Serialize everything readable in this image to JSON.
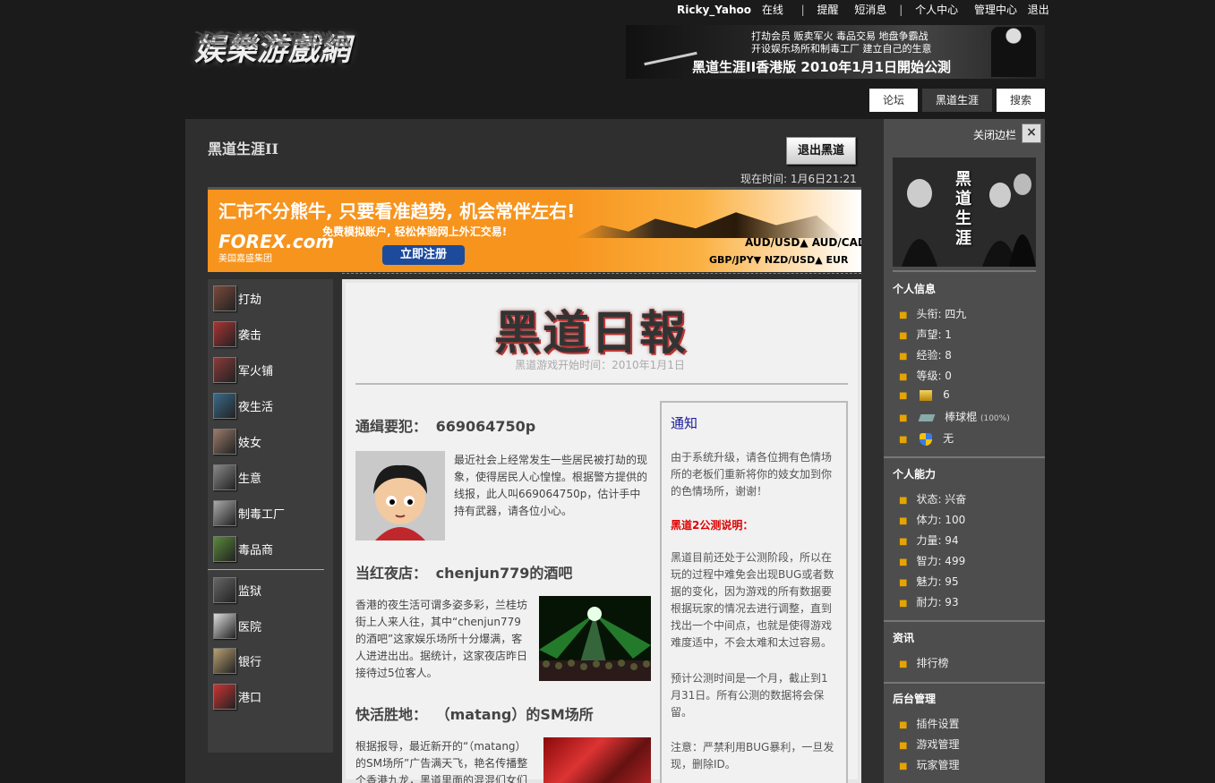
{
  "topbar": {
    "user": "Ricky_Yahoo",
    "online": "在线",
    "sep": "|",
    "remind": "提醒",
    "pm": "短消息",
    "usercenter": "个人中心",
    "admin": "管理中心",
    "logout": "退出"
  },
  "logo": {
    "text": "娱樂游戲網"
  },
  "top_banner": {
    "line1": "打劫会员  贩卖军火  毒品交易  地盘争霸战",
    "line2": "开设娱乐场所和制毒工厂  建立自己的生意",
    "line3": "黑道生涯II香港版 2010年1月1日開始公測"
  },
  "nav": [
    {
      "label": "论坛",
      "active": false
    },
    {
      "label": "黑道生涯",
      "active": true
    },
    {
      "label": "搜索",
      "active": false
    }
  ],
  "page": {
    "title": "黑道生涯II",
    "exit_button": "退出黑道",
    "now_time": "现在时间: 1月6日21:21"
  },
  "forex_ad": {
    "headline": "汇市不分熊牛, 只要看准趋势, 机会常伴左右!",
    "logo": "FOREX.com",
    "logo_sub": "美国嘉盛集团",
    "slogan": "免费模拟账户, 轻松体验网上外汇交易!",
    "register": "立即注册",
    "ticker1": "AUD/USD▲  AUD/CAD▼  EUR/C",
    "ticker2": "GBP/JPY▼  NZD/USD▲  EUR"
  },
  "left_menu": [
    {
      "label": "打劫",
      "icon": "robbery-icon",
      "color": "#7a4a3a"
    },
    {
      "label": "袭击",
      "icon": "attack-icon",
      "color": "#a33"
    },
    {
      "label": "军火铺",
      "icon": "weapon-icon",
      "color": "#8a3a3a"
    },
    {
      "label": "夜生活",
      "icon": "nightlife-icon",
      "color": "#3a6a8a"
    },
    {
      "label": "妓女",
      "icon": "girl-icon",
      "color": "#9a7a6a"
    },
    {
      "label": "生意",
      "icon": "building-icon",
      "color": "#888"
    },
    {
      "label": "制毒工厂",
      "icon": "factory-icon",
      "color": "#aaa"
    },
    {
      "label": "毒品商",
      "icon": "leaf-icon",
      "color": "#5a8a3a"
    },
    {
      "label": "监狱",
      "icon": "prison-icon",
      "color": "#666"
    },
    {
      "label": "医院",
      "icon": "hospital-icon",
      "color": "#ddd"
    },
    {
      "label": "银行",
      "icon": "bank-icon",
      "color": "#b8a070"
    },
    {
      "label": "港口",
      "icon": "harbor-icon",
      "color": "#c33"
    }
  ],
  "paper": {
    "masthead": "黑道日報",
    "start_date": "黑道游戏开始时间：2010年1月1日",
    "wanted": {
      "prefix": "通缉要犯：",
      "name": "669064750p",
      "text": "最近社会上经常发生一些居民被打劫的现象，使得居民人心惶惶。根据警方提供的线报，此人叫669064750p，估计手中持有武器，请各位小心。"
    },
    "club": {
      "prefix": "当红夜店：",
      "name": "chenjun779的酒吧",
      "text": "香港的夜生活可谓多姿多彩，兰桂坊街上人来人往，其中“chenjun779的酒吧”这家娱乐场所十分爆满，客人进进出出。据统计，这家夜店昨日接待过5位客人。"
    },
    "sm": {
      "prefix": "快活胜地：",
      "name": "（matang）的SM场所",
      "text": "根据报导，最近新开的“（matang）的SM场所”广告满天飞，艳名传播整个香港九龙，黑道里面的混混们女们"
    },
    "notice": {
      "title": "通知",
      "p1": "由于系统升级，请各位拥有色情场所的老板们重新将你的妓女加到你的色情场所，谢谢！",
      "red": "黑道2公测说明：",
      "p2": "黑道目前还处于公测阶段，所以在玩的过程中难免会出现BUG或者数据的变化，因为游戏的所有数据要根据玩家的情况去进行调整，直到找出一个中间点，也就是使得游戏难度适中，不会太难和太过容易。",
      "p3": "预计公测时间是一个月，截止到1月31日。所有公测的数据将会保留。",
      "p4": "注意：严禁利用BUG暴利，一旦发现，删除ID。"
    }
  },
  "sidebar": {
    "close": "关闭边栏",
    "close_x": "×",
    "poster_text": "黑道生涯",
    "personal_info_title": "个人信息",
    "personal_info": [
      {
        "label": "头衔: 四九"
      },
      {
        "label": "声望: 1"
      },
      {
        "label": "经验: 8"
      },
      {
        "label": "等级: 0"
      }
    ],
    "money": "6",
    "weapon": "棒球棍",
    "weapon_pct": "(100%)",
    "armor": "无",
    "ability_title": "个人能力",
    "ability": [
      {
        "label": "状态: 兴奋"
      },
      {
        "label": "体力: 100"
      },
      {
        "label": "力量: 94"
      },
      {
        "label": "智力: 499"
      },
      {
        "label": "魅力: 95"
      },
      {
        "label": "耐力: 93"
      }
    ],
    "news_title": "资讯",
    "news": [
      {
        "label": "排行榜"
      }
    ],
    "admin_title": "后台管理",
    "admin": [
      {
        "label": "插件设置"
      },
      {
        "label": "游戏管理"
      },
      {
        "label": "玩家管理"
      }
    ]
  }
}
